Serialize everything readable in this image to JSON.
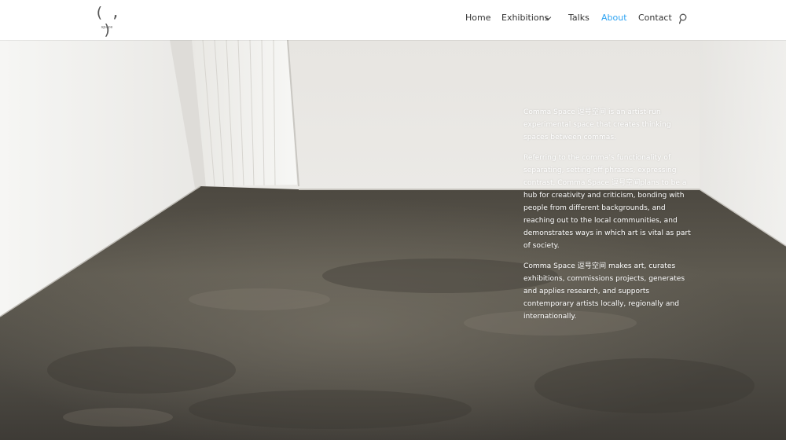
{
  "logo": {
    "mark": "( , )",
    "subtitle": "space"
  },
  "nav": {
    "home": "Home",
    "exhibitions": "Exhibitions",
    "talks": "Talks",
    "about": "About",
    "contact": "Contact"
  },
  "colors": {
    "active": "#2ea3f2",
    "nav_text": "#333333",
    "header_bg": "#ffffff"
  },
  "icons": {
    "search": "search-icon",
    "dropdown": "chevron-down-icon"
  },
  "about": {
    "p1": "Comma Space 逗号空间 is an artist-run experimental space that creates thinking spaces between commas.",
    "p2": "Referring to the comma’s functionality of separating, setting off phrases, expressing contrast, Comma Space 逗号空间plans to be a hub for creativity and criticism, bonding with people from different backgrounds, and reaching out to the local communities, and demonstrates ways in which art is vital as part of society.",
    "p3": "Comma Space 逗号空间 makes art, curates exhibitions, commissions projects, generates and applies research, and supports contemporary artists locally, regionally and internationally."
  }
}
